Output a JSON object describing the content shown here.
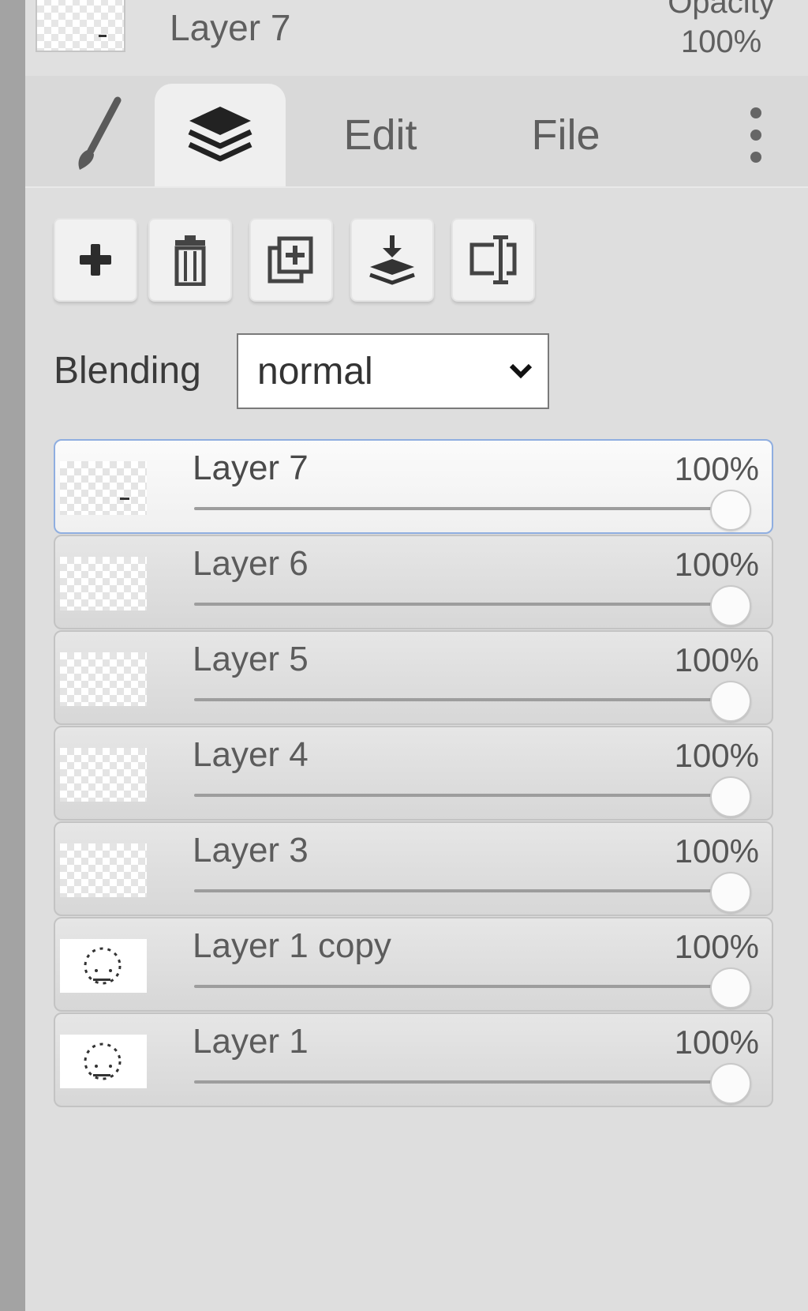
{
  "header": {
    "layer_name": "Layer 7",
    "opacity_label": "Opacity",
    "opacity_value": "100%"
  },
  "tabs": [
    {
      "name": "brush",
      "icon": "brush-icon"
    },
    {
      "name": "layers",
      "icon": "layers-icon",
      "selected": true
    },
    {
      "name": "edit",
      "label": "Edit"
    },
    {
      "name": "file",
      "label": "File"
    },
    {
      "name": "more",
      "icon": "more-vertical-icon"
    }
  ],
  "toolbar": {
    "buttons": [
      {
        "name": "add-layer-button",
        "icon": "plus-icon"
      },
      {
        "name": "delete-layer-button",
        "icon": "trash-icon"
      },
      {
        "name": "duplicate-layer-button",
        "icon": "duplicate-icon"
      },
      {
        "name": "merge-down-button",
        "icon": "merge-down-icon"
      },
      {
        "name": "rename-layer-button",
        "icon": "rename-icon"
      }
    ]
  },
  "blending": {
    "label": "Blending",
    "value": "normal"
  },
  "layers": [
    {
      "name": "Layer 7",
      "opacity": "100%",
      "opacity_value": 1.0,
      "thumb": "transparent-mark",
      "selected": true
    },
    {
      "name": "Layer 6",
      "opacity": "100%",
      "opacity_value": 1.0,
      "thumb": "transparent"
    },
    {
      "name": "Layer 5",
      "opacity": "100%",
      "opacity_value": 1.0,
      "thumb": "transparent"
    },
    {
      "name": "Layer 4",
      "opacity": "100%",
      "opacity_value": 1.0,
      "thumb": "transparent"
    },
    {
      "name": "Layer 3",
      "opacity": "100%",
      "opacity_value": 1.0,
      "thumb": "transparent"
    },
    {
      "name": "Layer 1 copy",
      "opacity": "100%",
      "opacity_value": 1.0,
      "thumb": "sketch"
    },
    {
      "name": "Layer 1",
      "opacity": "100%",
      "opacity_value": 1.0,
      "thumb": "sketch"
    }
  ],
  "colors": {
    "panel_bg": "#dedede",
    "selected_border": "#8faee0",
    "strip": "#a3a3a3"
  }
}
